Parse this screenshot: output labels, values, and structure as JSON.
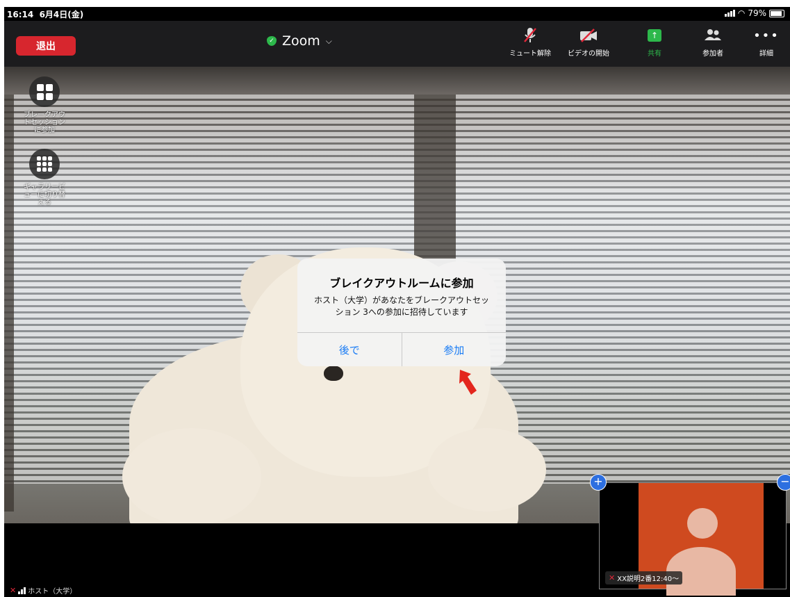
{
  "status": {
    "time": "16:14",
    "date": "6月4日(金)",
    "battery": "79%"
  },
  "toolbar": {
    "leave_label": "退出",
    "meeting_title": "Zoom",
    "unmute_label": "ミュート解除",
    "start_video_label": "ビデオの開始",
    "share_label": "共有",
    "participants_label": "参加者",
    "more_label": "詳細"
  },
  "side": {
    "breakout_label": "ブレークアウトセッションに参加",
    "gallery_label": "ギャラリービューに切り替える"
  },
  "dialog": {
    "title": "ブレイクアウトルームに参加",
    "message": "ホスト（大学）があなたをブレークアウトセッション 3への参加に招待しています",
    "later_label": "後で",
    "join_label": "参加"
  },
  "host_label": "ホスト（大学）",
  "thumbnail_label": "XX説明2番12:40〜",
  "colors": {
    "leave": "#d7262e",
    "share": "#2db84b",
    "link": "#1a7cf5",
    "avatar_bg": "#cf4a1f"
  }
}
